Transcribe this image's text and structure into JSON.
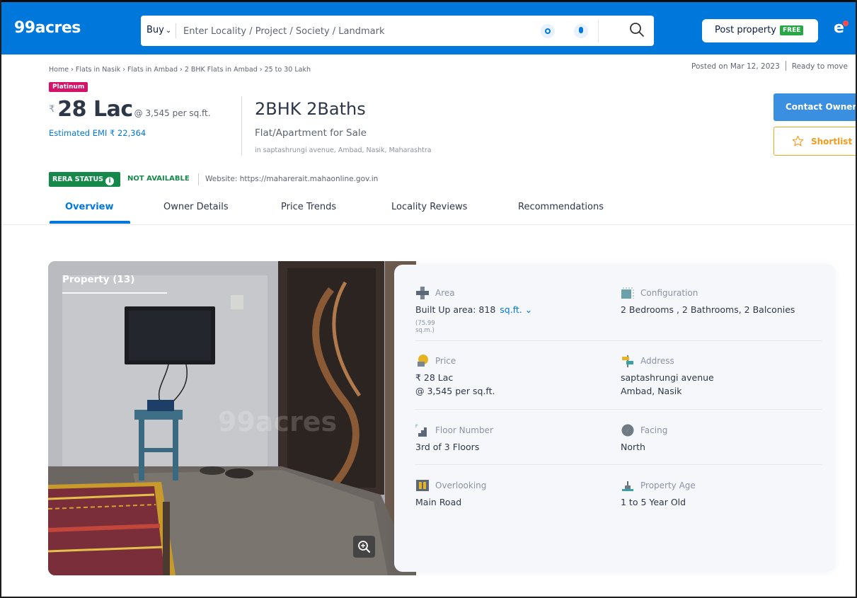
{
  "header": {
    "logo": "99acres",
    "buy_label": "Buy",
    "search_placeholder": "Enter Locality / Project / Society / Landmark",
    "post_property": "Post property",
    "free_badge": "FREE",
    "colors": {
      "brand": "#0078db"
    }
  },
  "breadcrumb": "Home › Flats in Nasik › Flats in Ambad › 2 BHK Flats in Ambad › 25 to 30 Lakh",
  "posted": {
    "date": "Posted on Mar 12, 2023",
    "status": "Ready to move"
  },
  "listing": {
    "badge": "Platinum",
    "rupee_symbol": "₹",
    "price": "28 Lac",
    "rate": "@ 3,545 per sq.ft.",
    "emi": "Estimated EMI ₹ 22,364",
    "title": "2BHK 2Baths",
    "type": "Flat/Apartment for Sale",
    "location": "in saptashrungi avenue, Ambad, Nasik, Maharashtra",
    "contact_button": "Contact Owner",
    "shortlist_button": "Shortlist"
  },
  "rera": {
    "badge": "RERA STATUS",
    "info_glyph": "i",
    "status": "NOT AVAILABLE",
    "website": "Website: https://maharerait.mahaonline.gov.in"
  },
  "tabs": [
    "Overview",
    "Owner Details",
    "Price Trends",
    "Locality Reviews",
    "Recommendations"
  ],
  "gallery": {
    "title": "Property (13)",
    "watermark": "99acres"
  },
  "details": {
    "area": {
      "label": "Area",
      "value": "Built Up area: 818",
      "unit": "sq.ft.",
      "sub": "(75.99 sq.m.)"
    },
    "configuration": {
      "label": "Configuration",
      "value": "2 Bedrooms , 2 Bathrooms, 2 Balconies"
    },
    "price": {
      "label": "Price",
      "line1": "₹ 28 Lac",
      "line2": "@ 3,545 per sq.ft."
    },
    "address": {
      "label": "Address",
      "line1": "saptashrungi avenue",
      "line2": "Ambad, Nasik"
    },
    "floor": {
      "label": "Floor Number",
      "value": "3rd  of 3 Floors"
    },
    "facing": {
      "label": "Facing",
      "value": "North"
    },
    "overlooking": {
      "label": "Overlooking",
      "value": "Main Road"
    },
    "age": {
      "label": "Property Age",
      "value": "1 to 5 Year Old"
    }
  },
  "icons": [
    "search-icon",
    "location-icon",
    "mic-icon",
    "user-icon",
    "star-icon",
    "info-icon",
    "zoom-icon",
    "area-icon",
    "configuration-icon",
    "price-icon",
    "address-icon",
    "floor-icon",
    "facing-icon",
    "overlooking-icon",
    "property-age-icon"
  ]
}
